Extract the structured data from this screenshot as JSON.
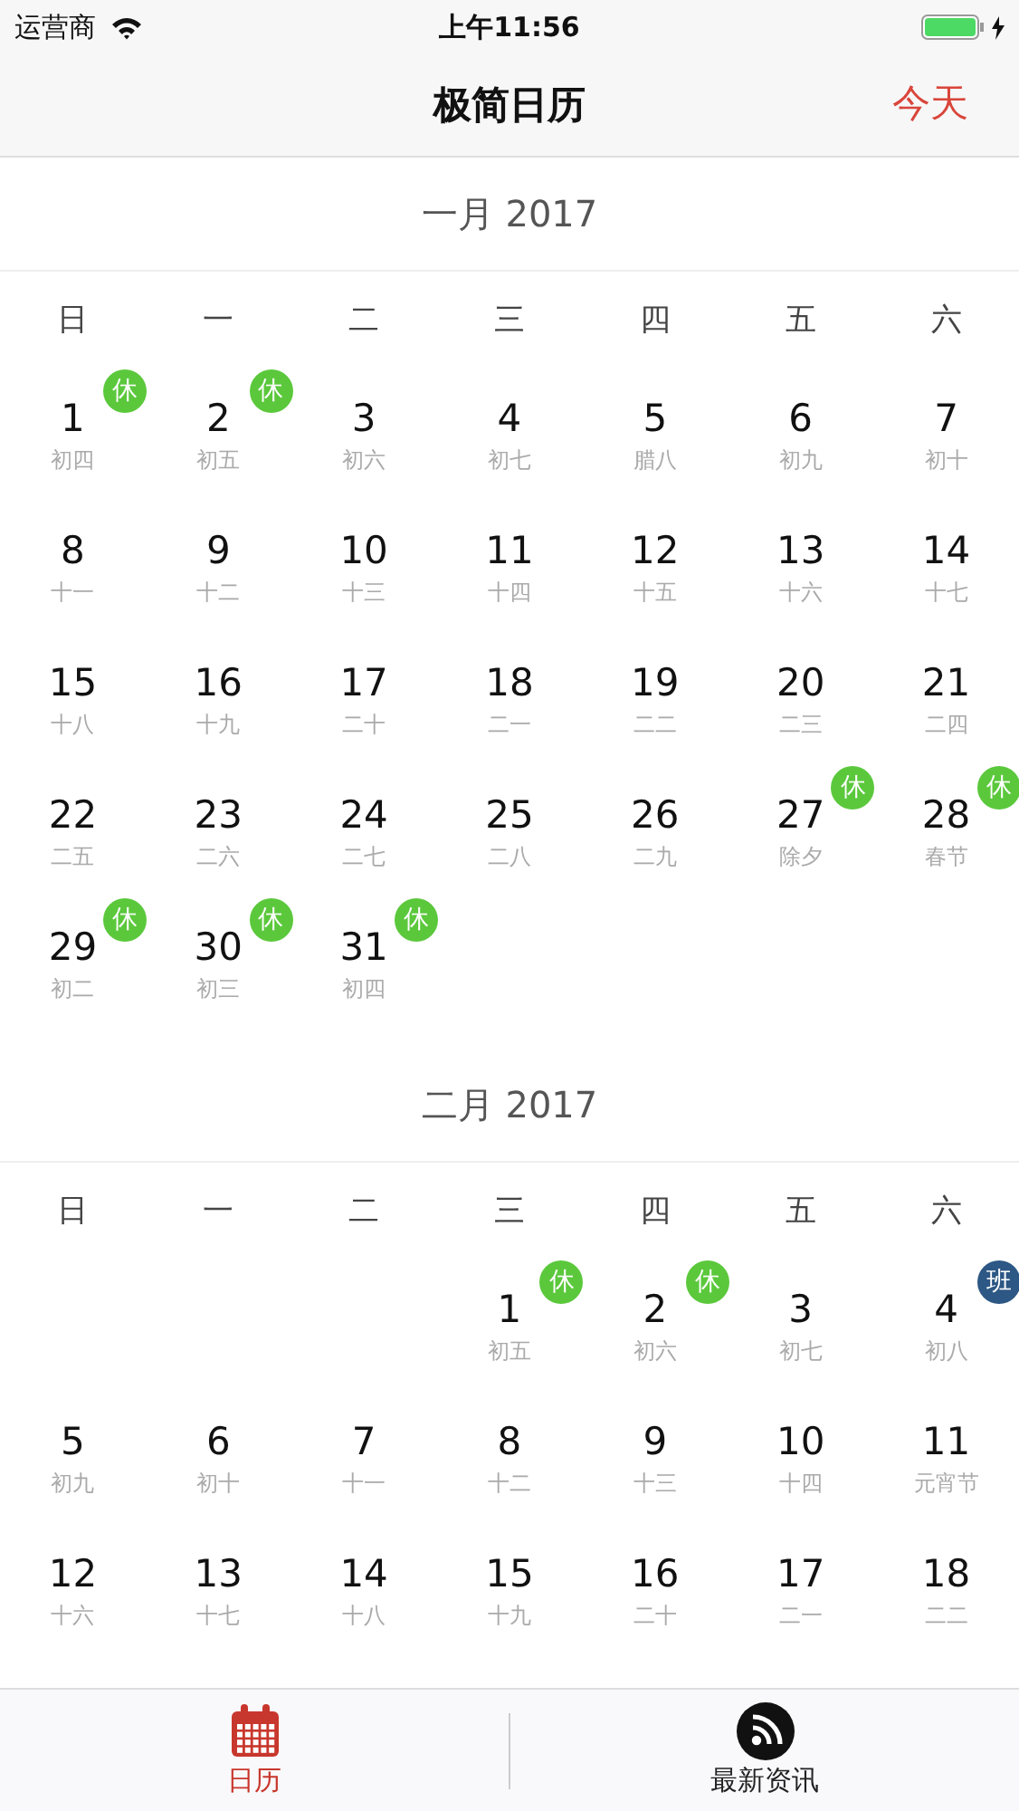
{
  "status_bar": {
    "carrier": "运营商",
    "time": "上午11:56"
  },
  "nav": {
    "title": "极简日历",
    "today_button": "今天"
  },
  "months": [
    {
      "title": "一月 2017",
      "weekdays": [
        "日",
        "一",
        "二",
        "三",
        "四",
        "五",
        "六"
      ],
      "weeks": [
        [
          {
            "kind": "day",
            "day": "1",
            "lunar": "初四",
            "badge": {
              "text": "休",
              "kind": "rest"
            }
          },
          {
            "kind": "day",
            "day": "2",
            "lunar": "初五",
            "badge": {
              "text": "休",
              "kind": "rest"
            }
          },
          {
            "kind": "day",
            "day": "3",
            "lunar": "初六"
          },
          {
            "kind": "day",
            "day": "4",
            "lunar": "初七"
          },
          {
            "kind": "day",
            "day": "5",
            "lunar": "腊八"
          },
          {
            "kind": "day",
            "day": "6",
            "lunar": "初九"
          },
          {
            "kind": "day",
            "day": "7",
            "lunar": "初十"
          }
        ],
        [
          {
            "kind": "day",
            "day": "8",
            "lunar": "十一"
          },
          {
            "kind": "day",
            "day": "9",
            "lunar": "十二"
          },
          {
            "kind": "day",
            "day": "10",
            "lunar": "十三"
          },
          {
            "kind": "day",
            "day": "11",
            "lunar": "十四"
          },
          {
            "kind": "day",
            "day": "12",
            "lunar": "十五"
          },
          {
            "kind": "day",
            "day": "13",
            "lunar": "十六"
          },
          {
            "kind": "day",
            "day": "14",
            "lunar": "十七"
          }
        ],
        [
          {
            "kind": "day",
            "day": "15",
            "lunar": "十八"
          },
          {
            "kind": "day",
            "day": "16",
            "lunar": "十九"
          },
          {
            "kind": "day",
            "day": "17",
            "lunar": "二十"
          },
          {
            "kind": "day",
            "day": "18",
            "lunar": "二一"
          },
          {
            "kind": "day",
            "day": "19",
            "lunar": "二二"
          },
          {
            "kind": "day",
            "day": "20",
            "lunar": "二三"
          },
          {
            "kind": "day",
            "day": "21",
            "lunar": "二四"
          }
        ],
        [
          {
            "kind": "day",
            "day": "22",
            "lunar": "二五"
          },
          {
            "kind": "day",
            "day": "23",
            "lunar": "二六"
          },
          {
            "kind": "day",
            "day": "24",
            "lunar": "二七"
          },
          {
            "kind": "day",
            "day": "25",
            "lunar": "二八"
          },
          {
            "kind": "day",
            "day": "26",
            "lunar": "二九"
          },
          {
            "kind": "day",
            "day": "27",
            "lunar": "除夕",
            "badge": {
              "text": "休",
              "kind": "rest"
            }
          },
          {
            "kind": "day",
            "day": "28",
            "lunar": "春节",
            "badge": {
              "text": "休",
              "kind": "rest"
            }
          }
        ],
        [
          {
            "kind": "day",
            "day": "29",
            "lunar": "初二",
            "badge": {
              "text": "休",
              "kind": "rest"
            }
          },
          {
            "kind": "day",
            "day": "30",
            "lunar": "初三",
            "badge": {
              "text": "休",
              "kind": "rest"
            }
          },
          {
            "kind": "day",
            "day": "31",
            "lunar": "初四",
            "badge": {
              "text": "休",
              "kind": "rest"
            }
          },
          {
            "kind": "blank"
          },
          {
            "kind": "blank"
          },
          {
            "kind": "blank"
          },
          {
            "kind": "blank"
          }
        ]
      ]
    },
    {
      "title": "二月 2017",
      "weekdays": [
        "日",
        "一",
        "二",
        "三",
        "四",
        "五",
        "六"
      ],
      "weeks": [
        [
          {
            "kind": "blank"
          },
          {
            "kind": "blank"
          },
          {
            "kind": "blank"
          },
          {
            "kind": "day",
            "day": "1",
            "lunar": "初五",
            "badge": {
              "text": "休",
              "kind": "rest"
            }
          },
          {
            "kind": "day",
            "day": "2",
            "lunar": "初六",
            "badge": {
              "text": "休",
              "kind": "rest"
            }
          },
          {
            "kind": "day",
            "day": "3",
            "lunar": "初七"
          },
          {
            "kind": "day",
            "day": "4",
            "lunar": "初八",
            "badge": {
              "text": "班",
              "kind": "work"
            }
          }
        ],
        [
          {
            "kind": "day",
            "day": "5",
            "lunar": "初九"
          },
          {
            "kind": "day",
            "day": "6",
            "lunar": "初十"
          },
          {
            "kind": "day",
            "day": "7",
            "lunar": "十一"
          },
          {
            "kind": "day",
            "day": "8",
            "lunar": "十二"
          },
          {
            "kind": "day",
            "day": "9",
            "lunar": "十三"
          },
          {
            "kind": "day",
            "day": "10",
            "lunar": "十四"
          },
          {
            "kind": "day",
            "day": "11",
            "lunar": "元宵节"
          }
        ],
        [
          {
            "kind": "day",
            "day": "12",
            "lunar": "十六"
          },
          {
            "kind": "day",
            "day": "13",
            "lunar": "十七"
          },
          {
            "kind": "day",
            "day": "14",
            "lunar": "十八"
          },
          {
            "kind": "day",
            "day": "15",
            "lunar": "十九"
          },
          {
            "kind": "day",
            "day": "16",
            "lunar": "二十"
          },
          {
            "kind": "day",
            "day": "17",
            "lunar": "二一"
          },
          {
            "kind": "day",
            "day": "18",
            "lunar": "二二"
          }
        ]
      ]
    }
  ],
  "tabs": [
    {
      "label": "日历",
      "kind": "calendar",
      "selected": true
    },
    {
      "label": "最新资讯",
      "kind": "feed",
      "selected": false
    }
  ]
}
